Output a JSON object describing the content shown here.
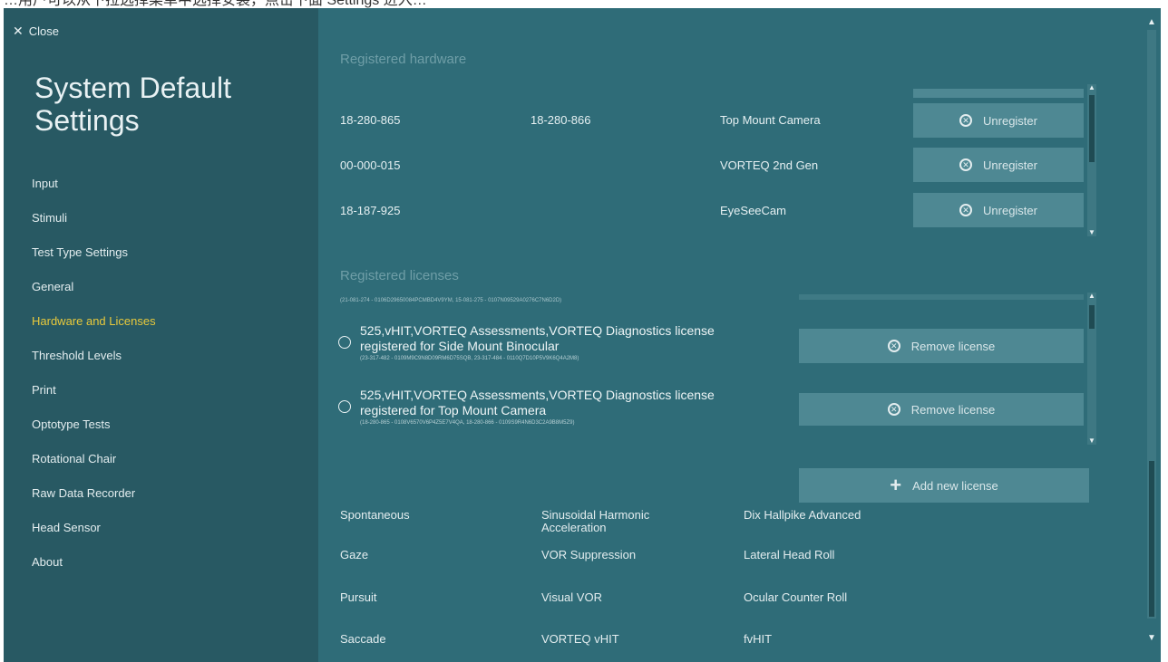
{
  "caption": "…用户可以从下拉选择菜单中选择安装，点击下面 Settings 进入…",
  "sidebar": {
    "close_label": "Close",
    "title": "System Default Settings",
    "items": [
      {
        "label": "Input"
      },
      {
        "label": "Stimuli"
      },
      {
        "label": "Test Type Settings"
      },
      {
        "label": "General"
      },
      {
        "label": "Hardware and Licenses",
        "active": true
      },
      {
        "label": "Threshold Levels"
      },
      {
        "label": "Print"
      },
      {
        "label": "Optotype Tests"
      },
      {
        "label": "Rotational Chair"
      },
      {
        "label": "Raw Data Recorder"
      },
      {
        "label": "Head Sensor"
      },
      {
        "label": "About"
      }
    ]
  },
  "hardware": {
    "section_title": "Registered hardware",
    "unregister_label": "Unregister",
    "rows": [
      {
        "serial1": "18-280-865",
        "serial2": "18-280-866",
        "device": "Top Mount Camera"
      },
      {
        "serial1": "00-000-015",
        "serial2": "",
        "device": "VORTEQ 2nd Gen"
      },
      {
        "serial1": "18-187-925",
        "serial2": "",
        "device": "EyeSeeCam"
      }
    ]
  },
  "licenses": {
    "section_title": "Registered licenses",
    "top_partial_serial": "(21-081-274 - 0106D29650084PCMBD4V9YM, 15-081-275 - 0107N09529A0276C7N6D2D)",
    "remove_label": "Remove license",
    "add_label": "Add new license",
    "items": [
      {
        "line1": "525,vHIT,VORTEQ Assessments,VORTEQ Diagnostics license",
        "line2": "registered for Side Mount Binocular",
        "serial": "(23-317-482 - 0109M9C9N8D09RM6D75SQB, 23-317-484 - 0110Q7D10P5V9K6Q4A2M8)"
      },
      {
        "line1": "525,vHIT,VORTEQ Assessments,VORTEQ Diagnostics license",
        "line2": "registered for Top Mount Camera",
        "serial": "(18-280-865 - 0108V6570V6P4Z5E7V4QA, 18-280-866 - 0109S9R4N6D3C2A9B8M5Z9)"
      }
    ]
  },
  "tests": [
    {
      "label": "Spontaneous"
    },
    {
      "label": "Sinusoidal Harmonic Acceleration"
    },
    {
      "label": "Dix Hallpike Advanced"
    },
    {
      "label": "Gaze"
    },
    {
      "label": "VOR Suppression"
    },
    {
      "label": "Lateral Head Roll"
    },
    {
      "label": "Pursuit"
    },
    {
      "label": "Visual VOR"
    },
    {
      "label": "Ocular Counter Roll"
    },
    {
      "label": "Saccade"
    },
    {
      "label": "VORTEQ vHIT"
    },
    {
      "label": "fvHIT"
    }
  ]
}
